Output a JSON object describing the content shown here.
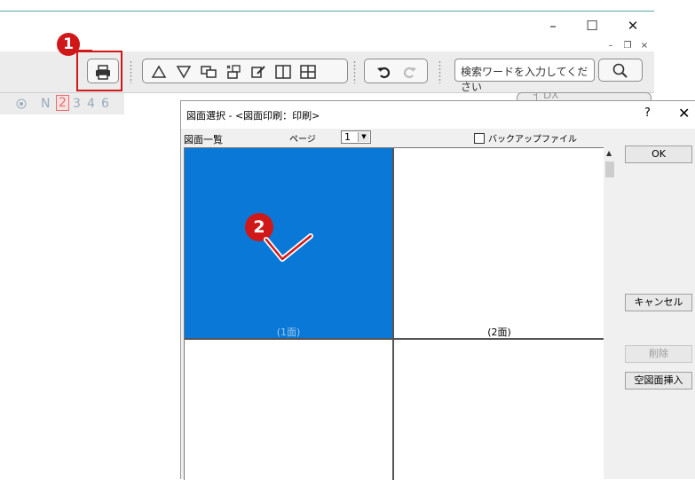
{
  "window_controls": {
    "minimize": "–",
    "maximize": "☐",
    "close": "✕"
  },
  "mdi_controls": {
    "minimize": "–",
    "restore": "❐",
    "close": "×"
  },
  "toolbar": {
    "print_tooltip_icon": "printer-icon",
    "search_placeholder": "検索ワードを入力してください"
  },
  "layer_strip": {
    "labels": [
      "N",
      "2",
      "3",
      "4",
      "6"
    ],
    "active": "2"
  },
  "bg_fragment": "┤  DX",
  "dialog": {
    "title": "図面選択 - <図面印刷：印刷>",
    "help": "?",
    "close": "✕",
    "list_label": "図面一覧",
    "page_label": "ページ",
    "page_value": "1",
    "backup_label": "バックアップファイル",
    "buttons": {
      "ok": "OK",
      "cancel": "キャンセル",
      "delete": "削除",
      "insert": "空図面挿入"
    },
    "cells": [
      {
        "label": "(1面)",
        "selected": true
      },
      {
        "label": "(2面)",
        "selected": false
      },
      {
        "label": "",
        "selected": false
      },
      {
        "label": "",
        "selected": false
      }
    ]
  },
  "annotations": {
    "step1": "1",
    "step2": "2"
  },
  "colors": {
    "selected": "#0a78d7",
    "callout": "#d01818"
  }
}
